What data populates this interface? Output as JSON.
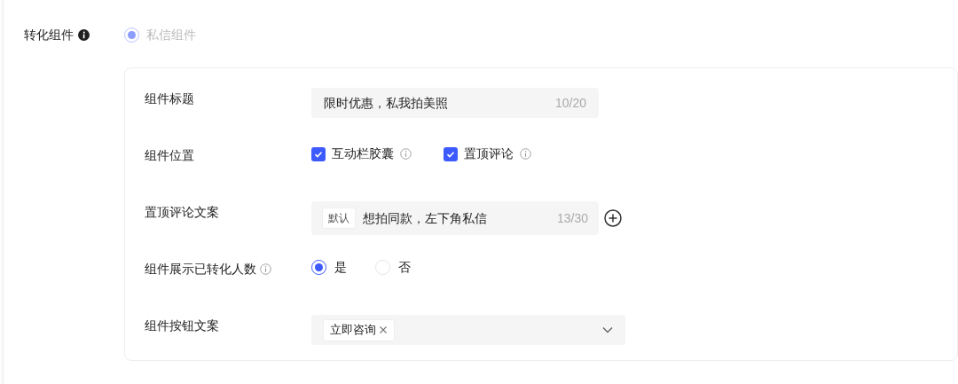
{
  "conversion_component": {
    "label": "转化组件",
    "options": [
      {
        "label": "私信组件",
        "selected": true,
        "disabled": true
      }
    ]
  },
  "fields": [
    {
      "kind": "text",
      "label": "组件标题",
      "value": "限时优惠，私我拍美照",
      "count": "10/20"
    },
    {
      "kind": "checkboxes",
      "label": "组件位置",
      "options": [
        {
          "label": "互动栏胶囊",
          "checked": true
        },
        {
          "label": "置顶评论",
          "checked": true
        }
      ]
    },
    {
      "kind": "comment",
      "label": "置顶评论文案",
      "tag": "默认",
      "value": "想拍同款，左下角私信",
      "count": "13/30"
    },
    {
      "kind": "radios",
      "label": "组件展示已转化人数",
      "info": true,
      "options": [
        {
          "label": "是",
          "selected": true
        },
        {
          "label": "否",
          "selected": false
        }
      ]
    },
    {
      "kind": "select",
      "label": "组件按钮文案",
      "tags": [
        "立即咨询"
      ]
    }
  ]
}
